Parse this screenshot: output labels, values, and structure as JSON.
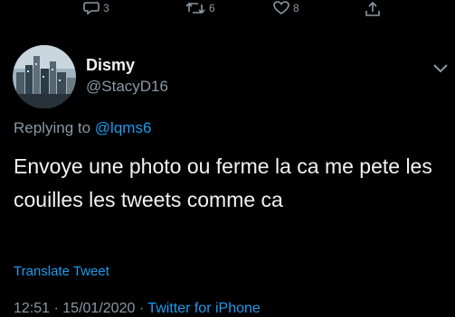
{
  "actions": {
    "reply_count": "3",
    "retweet_count": "6",
    "like_count": "8"
  },
  "tweet": {
    "author_name": "Dismy",
    "author_handle": "@StacyD16",
    "replying_prefix": "Replying to",
    "replying_to": "@lqms6",
    "text": "Envoye une photo ou ferme la ca me pete les couilles les tweets comme ca",
    "translate_label": "Translate Tweet",
    "time": "12:51",
    "separator": "·",
    "date": "15/01/2020",
    "source": "Twitter for iPhone"
  },
  "icons": {
    "reply": "reply-icon",
    "retweet": "retweet-icon",
    "like": "heart-icon",
    "share": "share-icon",
    "more": "chevron-down-icon"
  },
  "colors": {
    "background": "#000000",
    "text": "#e7e9ea",
    "secondary": "#8b98a5",
    "accent": "#1d9bf0"
  }
}
